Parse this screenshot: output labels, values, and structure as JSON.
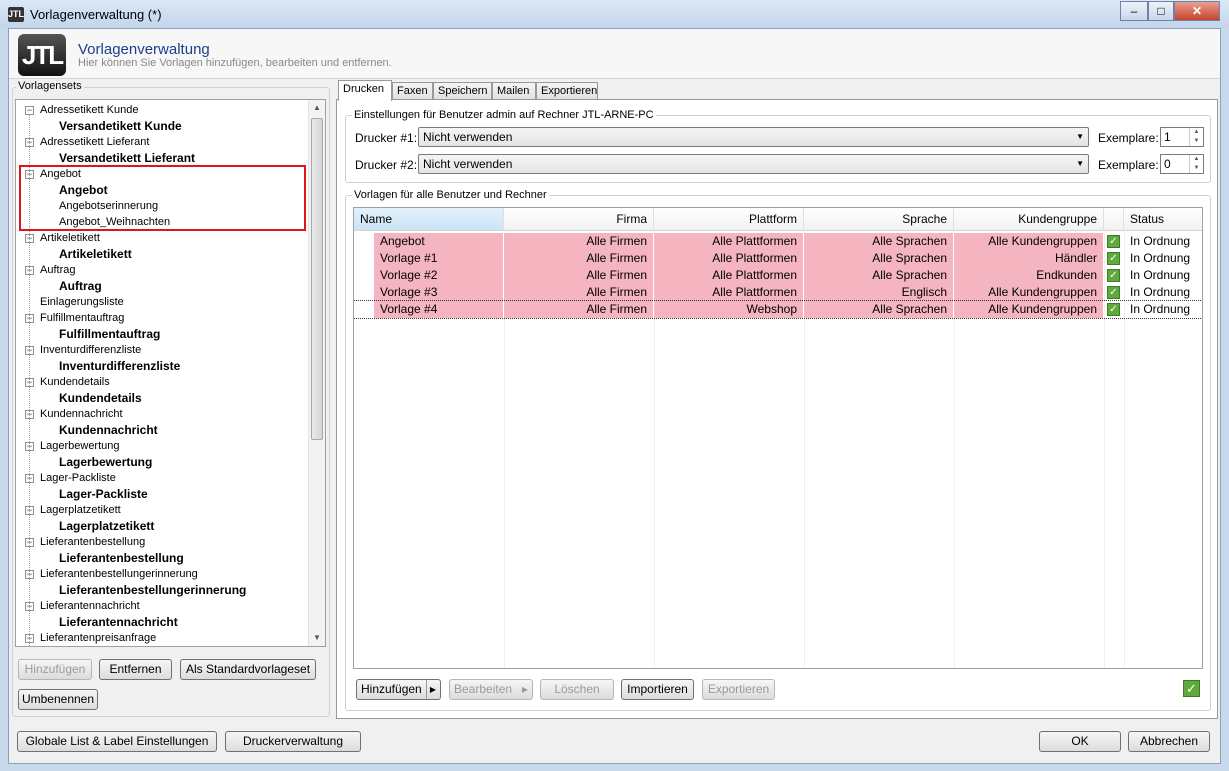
{
  "window": {
    "title": "Vorlagenverwaltung (*)",
    "logo": "JTL"
  },
  "header": {
    "title": "Vorlagenverwaltung",
    "subtitle": "Hier können Sie Vorlagen hinzufügen, bearbeiten und entfernen."
  },
  "sets": {
    "label": "Vorlagensets",
    "tree": [
      {
        "label": "Adressetikett Kunde",
        "level": 0,
        "bold": false
      },
      {
        "label": "Versandetikett Kunde",
        "level": 1,
        "bold": true
      },
      {
        "label": "Adressetikett Lieferant",
        "level": 0,
        "bold": false
      },
      {
        "label": "Versandetikett Lieferant",
        "level": 1,
        "bold": true
      },
      {
        "label": "Angebot",
        "level": 0,
        "bold": false
      },
      {
        "label": "Angebot",
        "level": 1,
        "bold": true
      },
      {
        "label": "Angebotserinnerung",
        "level": 1,
        "bold": false
      },
      {
        "label": "Angebot_Weihnachten",
        "level": 1,
        "bold": false
      },
      {
        "label": "Artikeletikett",
        "level": 0,
        "bold": false
      },
      {
        "label": "Artikeletikett",
        "level": 1,
        "bold": true
      },
      {
        "label": "Auftrag",
        "level": 0,
        "bold": false
      },
      {
        "label": "Auftrag",
        "level": 1,
        "bold": true
      },
      {
        "label": "Einlagerungsliste",
        "level": 0,
        "bold": false,
        "leaf": true
      },
      {
        "label": "Fulfillmentauftrag",
        "level": 0,
        "bold": false
      },
      {
        "label": "Fulfillmentauftrag",
        "level": 1,
        "bold": true
      },
      {
        "label": "Inventurdifferenzliste",
        "level": 0,
        "bold": false
      },
      {
        "label": "Inventurdifferenzliste",
        "level": 1,
        "bold": true
      },
      {
        "label": "Kundendetails",
        "level": 0,
        "bold": false
      },
      {
        "label": "Kundendetails",
        "level": 1,
        "bold": true
      },
      {
        "label": "Kundennachricht",
        "level": 0,
        "bold": false
      },
      {
        "label": "Kundennachricht",
        "level": 1,
        "bold": true
      },
      {
        "label": "Lagerbewertung",
        "level": 0,
        "bold": false
      },
      {
        "label": "Lagerbewertung",
        "level": 1,
        "bold": true
      },
      {
        "label": "Lager-Packliste",
        "level": 0,
        "bold": false
      },
      {
        "label": "Lager-Packliste",
        "level": 1,
        "bold": true
      },
      {
        "label": "Lagerplatzetikett",
        "level": 0,
        "bold": false
      },
      {
        "label": "Lagerplatzetikett",
        "level": 1,
        "bold": true
      },
      {
        "label": "Lieferantenbestellung",
        "level": 0,
        "bold": false
      },
      {
        "label": "Lieferantenbestellung",
        "level": 1,
        "bold": true
      },
      {
        "label": "Lieferantenbestellungerinnerung",
        "level": 0,
        "bold": false
      },
      {
        "label": "Lieferantenbestellungerinnerung",
        "level": 1,
        "bold": true
      },
      {
        "label": "Lieferantennachricht",
        "level": 0,
        "bold": false
      },
      {
        "label": "Lieferantennachricht",
        "level": 1,
        "bold": true
      },
      {
        "label": "Lieferantenpreisanfrage",
        "level": 0,
        "bold": false
      }
    ],
    "buttons": {
      "add": "Hinzufügen",
      "remove": "Entfernen",
      "default": "Als Standardvorlageset",
      "rename": "Umbenennen"
    }
  },
  "tabs": [
    "Drucken",
    "Faxen",
    "Speichern",
    "Mailen",
    "Exportieren"
  ],
  "printer": {
    "group_label": "Einstellungen für Benutzer admin auf Rechner JTL-ARNE-PC",
    "p1_label": "Drucker #1:",
    "p1_value": "Nicht verwenden",
    "p2_label": "Drucker #2:",
    "p2_value": "Nicht verwenden",
    "copies_label": "Exemplare:",
    "copies1": "1",
    "copies2": "0"
  },
  "templates": {
    "group_label": "Vorlagen für alle Benutzer und Rechner",
    "columns": [
      "Name",
      "Firma",
      "Plattform",
      "Sprache",
      "Kundengruppe",
      "",
      "Status"
    ],
    "rows": [
      [
        "Angebot",
        "Alle Firmen",
        "Alle Plattformen",
        "Alle Sprachen",
        "Alle Kundengruppen",
        "In Ordnung"
      ],
      [
        "Vorlage #1",
        "Alle Firmen",
        "Alle Plattformen",
        "Alle Sprachen",
        "Händler",
        "In Ordnung"
      ],
      [
        "Vorlage #2",
        "Alle Firmen",
        "Alle Plattformen",
        "Alle Sprachen",
        "Endkunden",
        "In Ordnung"
      ],
      [
        "Vorlage #3",
        "Alle Firmen",
        "Alle Plattformen",
        "Englisch",
        "Alle Kundengruppen",
        "In Ordnung"
      ],
      [
        "Vorlage #4",
        "Alle Firmen",
        "Webshop",
        "Alle Sprachen",
        "Alle Kundengruppen",
        "In Ordnung"
      ]
    ],
    "row_color": "#f4b4c0",
    "buttons": {
      "add": "Hinzufügen",
      "edit": "Bearbeiten",
      "delete": "Löschen",
      "import": "Importieren",
      "export": "Exportieren"
    }
  },
  "footer": {
    "global": "Globale List & Label Einstellungen",
    "printers": "Druckerverwaltung",
    "ok": "OK",
    "cancel": "Abbrechen"
  }
}
